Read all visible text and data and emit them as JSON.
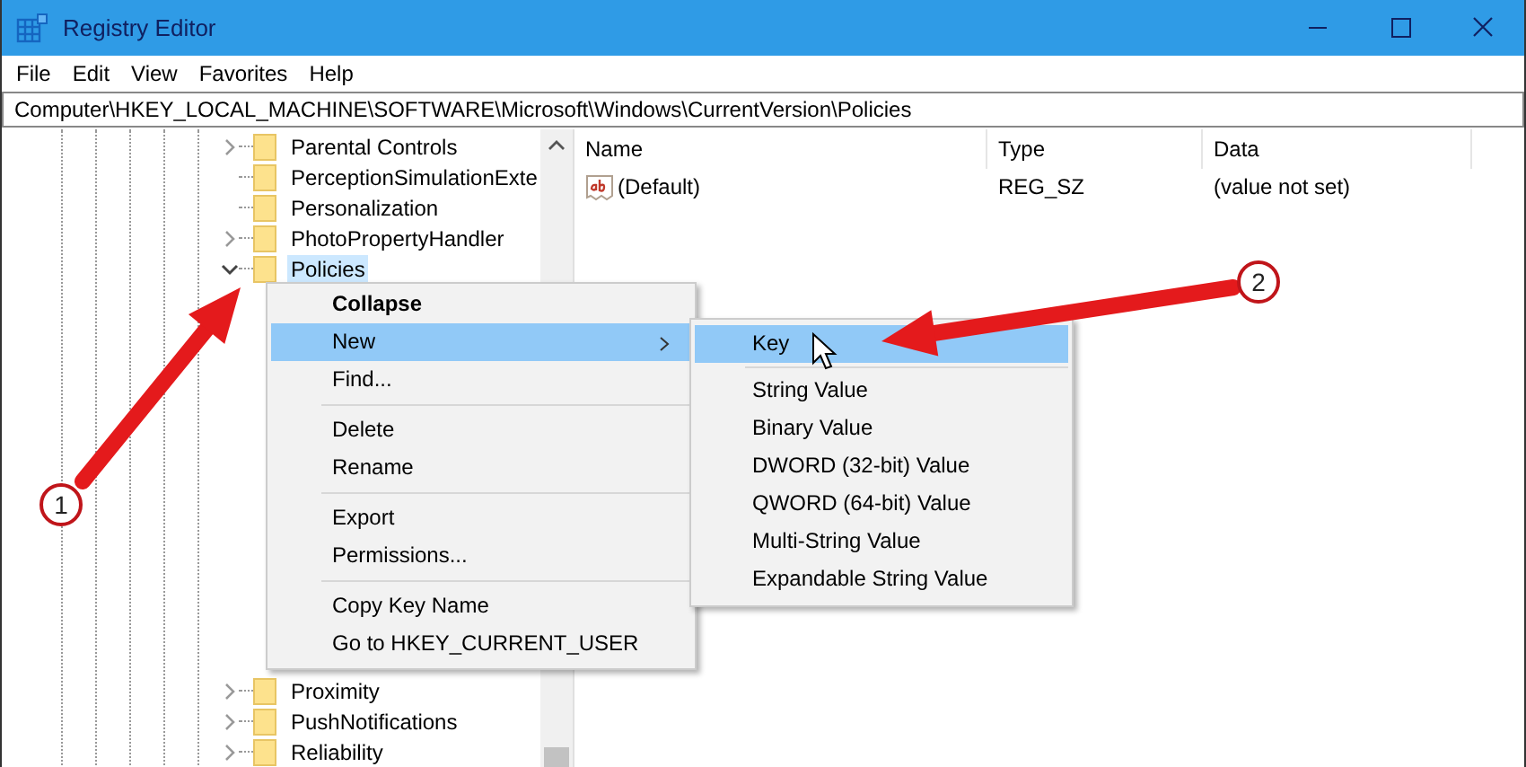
{
  "window": {
    "title": "Registry Editor"
  },
  "menu_bar": [
    "File",
    "Edit",
    "View",
    "Favorites",
    "Help"
  ],
  "address": "Computer\\HKEY_LOCAL_MACHINE\\SOFTWARE\\Microsoft\\Windows\\CurrentVersion\\Policies",
  "tree": {
    "items": [
      {
        "label": "Parental Controls",
        "expandable": true,
        "expanded": false,
        "selected": false
      },
      {
        "label": "PerceptionSimulationExte",
        "expandable": false,
        "expanded": false,
        "selected": false
      },
      {
        "label": "Personalization",
        "expandable": false,
        "expanded": false,
        "selected": false
      },
      {
        "label": "PhotoPropertyHandler",
        "expandable": true,
        "expanded": false,
        "selected": false
      },
      {
        "label": "Policies",
        "expandable": true,
        "expanded": true,
        "selected": true
      },
      {
        "label": "Proximity",
        "expandable": true,
        "expanded": false,
        "selected": false
      },
      {
        "label": "PushNotifications",
        "expandable": true,
        "expanded": false,
        "selected": false
      },
      {
        "label": "Reliability",
        "expandable": true,
        "expanded": false,
        "selected": false
      }
    ]
  },
  "values": {
    "columns": [
      "Name",
      "Type",
      "Data"
    ],
    "rows": [
      {
        "name": "(Default)",
        "type": "REG_SZ",
        "data": "(value not set)"
      }
    ]
  },
  "context_menu": {
    "items": [
      {
        "kind": "item",
        "label": "Collapse",
        "default": true,
        "submenu": false,
        "selected": false
      },
      {
        "kind": "item",
        "label": "New",
        "default": false,
        "submenu": true,
        "selected": true
      },
      {
        "kind": "item",
        "label": "Find...",
        "default": false,
        "submenu": false,
        "selected": false
      },
      {
        "kind": "separator"
      },
      {
        "kind": "item",
        "label": "Delete",
        "default": false,
        "submenu": false,
        "selected": false
      },
      {
        "kind": "item",
        "label": "Rename",
        "default": false,
        "submenu": false,
        "selected": false
      },
      {
        "kind": "separator"
      },
      {
        "kind": "item",
        "label": "Export",
        "default": false,
        "submenu": false,
        "selected": false
      },
      {
        "kind": "item",
        "label": "Permissions...",
        "default": false,
        "submenu": false,
        "selected": false
      },
      {
        "kind": "separator"
      },
      {
        "kind": "item",
        "label": "Copy Key Name",
        "default": false,
        "submenu": false,
        "selected": false
      },
      {
        "kind": "item",
        "label": "Go to HKEY_CURRENT_USER",
        "default": false,
        "submenu": false,
        "selected": false
      }
    ]
  },
  "submenu": {
    "items": [
      {
        "kind": "item",
        "label": "Key",
        "selected": true
      },
      {
        "kind": "separator"
      },
      {
        "kind": "item",
        "label": "String Value",
        "selected": false
      },
      {
        "kind": "item",
        "label": "Binary Value",
        "selected": false
      },
      {
        "kind": "item",
        "label": "DWORD (32-bit) Value",
        "selected": false
      },
      {
        "kind": "item",
        "label": "QWORD (64-bit) Value",
        "selected": false
      },
      {
        "kind": "item",
        "label": "Multi-String Value",
        "selected": false
      },
      {
        "kind": "item",
        "label": "Expandable String Value",
        "selected": false
      }
    ]
  },
  "callouts": [
    {
      "number": "1"
    },
    {
      "number": "2"
    }
  ]
}
